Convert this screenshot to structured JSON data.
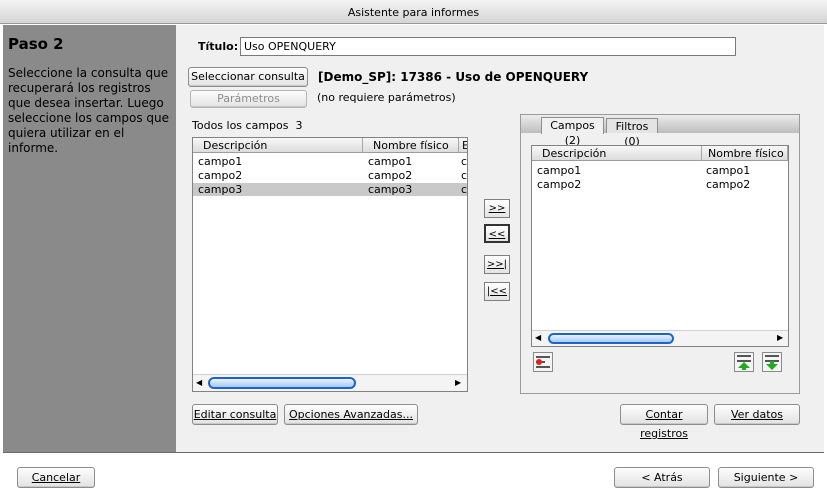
{
  "window": {
    "title": "Asistente para informes"
  },
  "step": {
    "title": "Paso 2",
    "description": "Seleccione la consulta que recuperará los registros que desea insertar. Luego seleccione los campos que quiera utilizar en el informe."
  },
  "form": {
    "title_label": "Título:",
    "title_value": "Uso OPENQUERY",
    "select_query_button": "Seleccionar consulta",
    "query_info": "[Demo_SP]: 17386 - Uso de OPENQUERY",
    "parameters_button": "Parámetros",
    "parameters_info": "(no requiere parámetros)"
  },
  "all_fields": {
    "label": "Todos los campos",
    "count": "3",
    "columns": [
      "Descripción",
      "Nombre físico",
      "E"
    ],
    "rows": [
      {
        "descripcion": "campo1",
        "nombre": "campo1",
        "extra": "c"
      },
      {
        "descripcion": "campo2",
        "nombre": "campo2",
        "extra": "c"
      },
      {
        "descripcion": "campo3",
        "nombre": "campo3",
        "extra": "c"
      }
    ],
    "selected_row": 2
  },
  "transfer_buttons": {
    "add": ">>",
    "remove": "<<",
    "add_all": ">>|",
    "remove_all": "|<<"
  },
  "tabs": [
    {
      "label": "Campos (2)",
      "active": true
    },
    {
      "label": "Filtros (0)",
      "active": false
    }
  ],
  "selected_fields": {
    "columns": [
      "Descripción",
      "Nombre físico"
    ],
    "rows": [
      {
        "descripcion": "campo1",
        "nombre": "campo1"
      },
      {
        "descripcion": "campo2",
        "nombre": "campo2"
      }
    ]
  },
  "actions": {
    "edit_query": "Editar consulta",
    "advanced_options": "Opciones Avanzadas...",
    "count_records": "Contar registros",
    "view_data": "Ver datos"
  },
  "footer": {
    "cancel": "Cancelar",
    "back": "< Atrás",
    "next": "Siguiente >"
  }
}
